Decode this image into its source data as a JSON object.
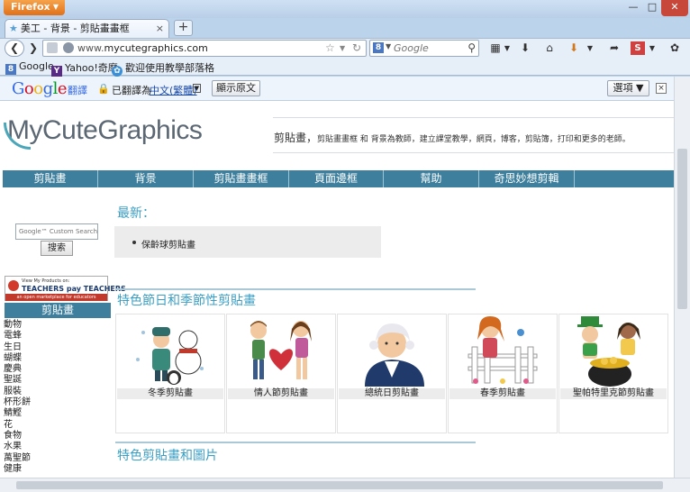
{
  "browser": {
    "app_button": "Firefox",
    "tab_title": "美工 - 背景 - 剪貼畫畫框",
    "url_host": "www.",
    "url_domain": "mycutegraphics.com",
    "search_placeholder": "Google",
    "bookmarks": [
      "Google",
      "Yahoo!奇摩",
      "歡迎使用教學部落格"
    ]
  },
  "translate_bar": {
    "logo_g": "G",
    "logo_o1": "o",
    "logo_o2": "o",
    "logo_g2": "g",
    "logo_l": "l",
    "logo_e": "e",
    "label": "翻譯",
    "translated_to": "已翻譯為",
    "language": "中文(繁體)",
    "show_original": "顯示原文",
    "options": "選項 ▼"
  },
  "site": {
    "logo": "MyCuteGraphics",
    "tagline_lead": "剪貼畫，",
    "tagline_rest": "剪貼畫畫框 和 背景為教師，建立課堂教學，網頁，博客，剪貼簿，打印和更多的老師。",
    "menu": [
      "剪貼畫",
      "背景",
      "剪貼畫畫框",
      "頁面邊框",
      "幫助",
      "奇思妙想剪輯"
    ],
    "search_placeholder": "Google™ Custom Search",
    "search_button": "搜索",
    "tpt_line1": "View My Products on:",
    "tpt_line2": "TEACHERS pay TEACHERS",
    "tpt_line3": "an open marketplace for educators",
    "category_header": "剪貼畫",
    "categories": [
      "動物",
      "電蜂",
      "生日",
      "蝴蝶",
      "慶典",
      "聖誕",
      "服裝",
      "杯形餅",
      "鯖鰹",
      "花",
      "食物",
      "水果",
      "萬聖節",
      "健康"
    ],
    "latest_title": "最新：",
    "latest_item": "保齡球剪貼畫",
    "holiday_title": "特色節日和季節性剪貼畫",
    "holiday_cards": [
      "冬季剪貼畫",
      "情人節剪貼畫",
      "總統日剪貼畫",
      "春季剪貼畫",
      "聖帕特里克節剪貼畫"
    ],
    "featured_title": "特色剪貼畫和圖片"
  }
}
